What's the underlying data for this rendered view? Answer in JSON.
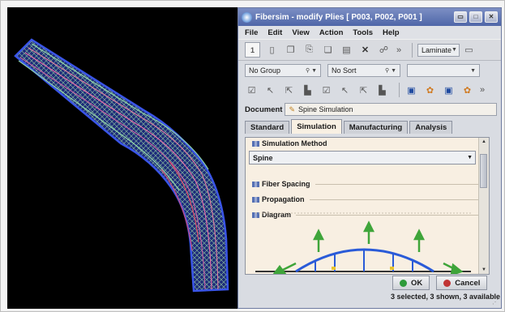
{
  "window": {
    "title": "Fibersim - modify Plies [ P003, P002, P001 ]",
    "controls": [
      "▭",
      "□",
      "✕"
    ]
  },
  "menu": [
    "File",
    "Edit",
    "View",
    "Action",
    "Tools",
    "Help"
  ],
  "toolbar": {
    "count_label": "1",
    "overflow": "»",
    "laminate_label": "Laminate"
  },
  "filters": {
    "group_label": "No Group",
    "sort_label": "No Sort",
    "third_label": ""
  },
  "document": {
    "label": "Document",
    "value": "Spine Simulation"
  },
  "tabs": [
    "Standard",
    "Simulation",
    "Manufacturing",
    "Analysis"
  ],
  "active_tab": "Simulation",
  "simulation": {
    "method_header": "Simulation Method",
    "method_value": "Spine",
    "sections": [
      "Fiber Spacing",
      "Propagation",
      "Diagram"
    ]
  },
  "buttons": {
    "ok_label": "OK",
    "cancel_label": "Cancel"
  },
  "status": "3 selected, 3 shown, 3 available",
  "colors": {
    "viewport_background": "#000000",
    "ply_outline": "#3a55e8",
    "diagram_arrows": "#3fa53a",
    "diagram_arc": "#2a5bd8",
    "ok_indicator": "#2e9a3a",
    "cancel_indicator": "#c03434"
  }
}
